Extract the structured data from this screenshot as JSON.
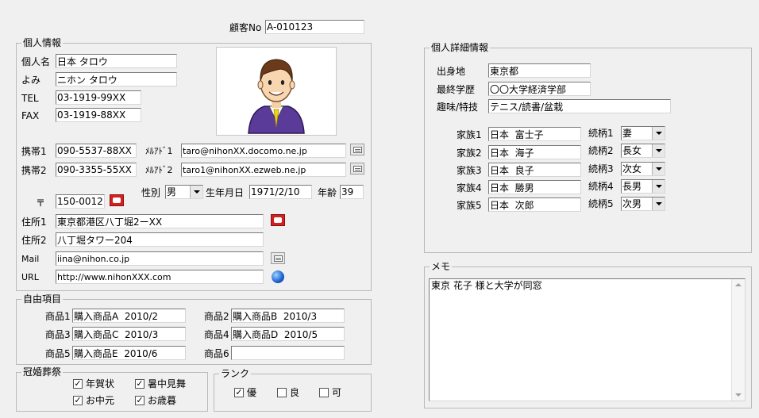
{
  "customer_no": {
    "label": "顧客No",
    "value": "A-010123"
  },
  "personal": {
    "legend": "個人情報",
    "name_label": "個人名",
    "name": "日本 タロウ",
    "yomi_label": "よみ",
    "yomi": "ニホン タロウ",
    "tel_label": "TEL",
    "tel": "03-1919-99XX",
    "fax_label": "FAX",
    "fax": "03-1919-88XX",
    "mobile1_label": "携帯1",
    "mobile1": "090-5537-88XX",
    "mobile2_label": "携帯2",
    "mobile2": "090-3355-55XX",
    "mail1_label": "ﾒﾙｱﾄﾞ1",
    "mail1": "taro@nihonXX.docomo.ne.jp",
    "mail2_label": "ﾒﾙｱﾄﾞ2",
    "mail2": "taro1@nihonXX.ezweb.ne.jp",
    "gender_label": "性別",
    "gender": "男",
    "birth_label": "生年月日",
    "birth": "1971/2/10",
    "age_label": "年齢",
    "age": "39",
    "zip_label": "〒",
    "zip": "150-0012",
    "addr1_label": "住所1",
    "addr1": "東京都港区八丁堀2ーXX",
    "addr2_label": "住所2",
    "addr2": "八丁堀タワー204",
    "email_label": "Mail",
    "email": "iina@nihon.co.jp",
    "url_label": "URL",
    "url": "http://www.nihonXXX.com"
  },
  "free": {
    "legend": "自由項目",
    "items": [
      {
        "label": "商品1",
        "value": "購入商品A  2010/2"
      },
      {
        "label": "商品2",
        "value": "購入商品B  2010/3"
      },
      {
        "label": "商品3",
        "value": "購入商品C  2010/3"
      },
      {
        "label": "商品4",
        "value": "購入商品D  2010/5"
      },
      {
        "label": "商品5",
        "value": "購入商品E  2010/6"
      },
      {
        "label": "商品6",
        "value": ""
      }
    ]
  },
  "ceremony": {
    "legend": "冠婚葬祭",
    "items": [
      {
        "label": "年賀状",
        "checked": true
      },
      {
        "label": "暑中見舞",
        "checked": true
      },
      {
        "label": "お中元",
        "checked": true
      },
      {
        "label": "お歳暮",
        "checked": true
      }
    ]
  },
  "rank": {
    "legend": "ランク",
    "items": [
      {
        "label": "優",
        "checked": true
      },
      {
        "label": "良",
        "checked": false
      },
      {
        "label": "可",
        "checked": false
      }
    ]
  },
  "detail": {
    "legend": "個人詳細情報",
    "birthplace_label": "出身地",
    "birthplace": "東京都",
    "education_label": "最終学歴",
    "education": "〇〇大学経済学部",
    "hobby_label": "趣味/特技",
    "hobby": "テニス/読書/盆栽",
    "family": [
      {
        "label": "家族1",
        "name": "日本  富士子",
        "rel_label": "続柄1",
        "rel": "妻"
      },
      {
        "label": "家族2",
        "name": "日本  海子",
        "rel_label": "続柄2",
        "rel": "長女"
      },
      {
        "label": "家族3",
        "name": "日本  良子",
        "rel_label": "続柄3",
        "rel": "次女"
      },
      {
        "label": "家族4",
        "name": "日本  勝男",
        "rel_label": "続柄4",
        "rel": "長男"
      },
      {
        "label": "家族5",
        "name": "日本  次郎",
        "rel_label": "続柄5",
        "rel": "次男"
      }
    ]
  },
  "memo": {
    "legend": "メモ",
    "text": "東京  花子  様と大学が同窓"
  },
  "icons": {
    "photo": "businessman-portrait",
    "mail": "mail-icon",
    "map": "map-icon",
    "globe": "globe-icon"
  }
}
